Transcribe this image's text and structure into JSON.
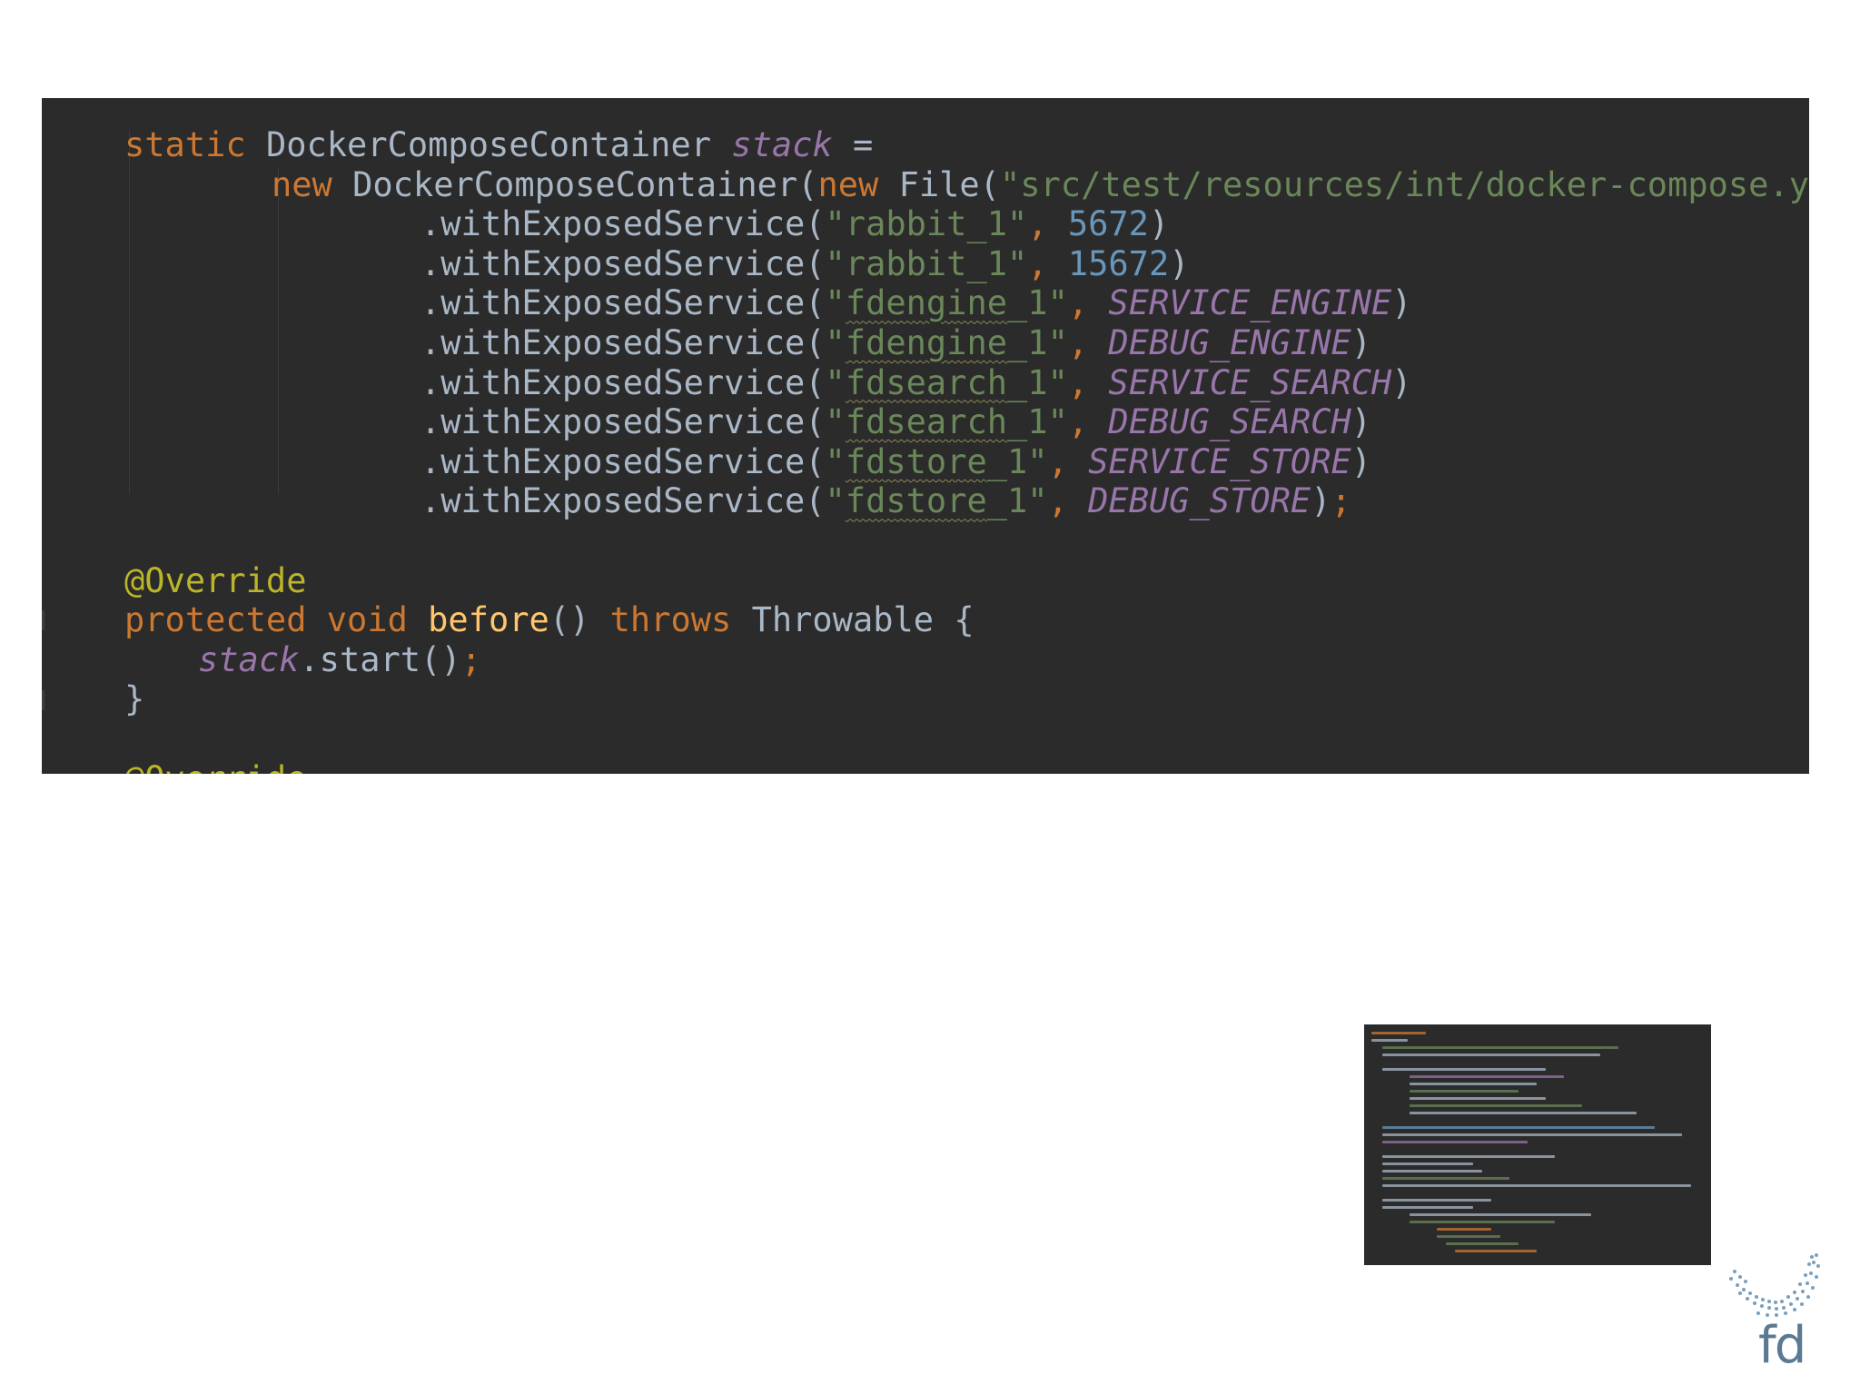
{
  "code": {
    "lines": [
      [
        [
          "kw",
          "static "
        ],
        [
          "cls",
          "DockerComposeContainer "
        ],
        [
          "field",
          "stack"
        ],
        [
          "punct",
          " ="
        ]
      ],
      [
        [
          "kw",
          "new "
        ],
        [
          "cls",
          "DockerComposeContainer("
        ],
        [
          "kw",
          "new "
        ],
        [
          "cls",
          "File("
        ],
        [
          "str",
          "\"src/test/resources/int/docker-compose.yml\""
        ],
        [
          "punct",
          "))"
        ]
      ],
      [
        [
          "punct",
          ".withExposedService("
        ],
        [
          "str",
          "\"rabbit_1\""
        ],
        [
          "kw",
          ", "
        ],
        [
          "num",
          "5672"
        ],
        [
          "punct",
          ")"
        ]
      ],
      [
        [
          "punct",
          ".withExposedService("
        ],
        [
          "str",
          "\"rabbit_1\""
        ],
        [
          "kw",
          ", "
        ],
        [
          "num",
          "15672"
        ],
        [
          "punct",
          ")"
        ]
      ],
      [
        [
          "punct",
          ".withExposedService("
        ],
        [
          "str",
          "\""
        ],
        [
          "str typo",
          "fdengine"
        ],
        [
          "str",
          "_1\""
        ],
        [
          "kw",
          ", "
        ],
        [
          "const",
          "SERVICE_ENGINE"
        ],
        [
          "punct",
          ")"
        ]
      ],
      [
        [
          "punct",
          ".withExposedService("
        ],
        [
          "str",
          "\""
        ],
        [
          "str typo",
          "fdengine"
        ],
        [
          "str",
          "_1\""
        ],
        [
          "kw",
          ", "
        ],
        [
          "const",
          "DEBUG_ENGINE"
        ],
        [
          "punct",
          ")"
        ]
      ],
      [
        [
          "punct",
          ".withExposedService("
        ],
        [
          "str",
          "\""
        ],
        [
          "str typo",
          "fdsearch"
        ],
        [
          "str",
          "_1\""
        ],
        [
          "kw",
          ", "
        ],
        [
          "const",
          "SERVICE_SEARCH"
        ],
        [
          "punct",
          ")"
        ]
      ],
      [
        [
          "punct",
          ".withExposedService("
        ],
        [
          "str",
          "\""
        ],
        [
          "str typo",
          "fdsearch"
        ],
        [
          "str",
          "_1\""
        ],
        [
          "kw",
          ", "
        ],
        [
          "const",
          "DEBUG_SEARCH"
        ],
        [
          "punct",
          ")"
        ]
      ],
      [
        [
          "punct",
          ".withExposedService("
        ],
        [
          "str",
          "\""
        ],
        [
          "str typo",
          "fdstore"
        ],
        [
          "str",
          "_1\""
        ],
        [
          "kw",
          ", "
        ],
        [
          "const",
          "SERVICE_STORE"
        ],
        [
          "punct",
          ")"
        ]
      ],
      [
        [
          "punct",
          ".withExposedService("
        ],
        [
          "str",
          "\""
        ],
        [
          "str typo",
          "fdstore"
        ],
        [
          "str",
          "_1\""
        ],
        [
          "kw",
          ", "
        ],
        [
          "const",
          "DEBUG_STORE"
        ],
        [
          "punct",
          ")"
        ],
        [
          "semi",
          ";"
        ]
      ],
      [],
      [
        [
          "ann",
          "@Override"
        ]
      ],
      [
        [
          "kw",
          "protected "
        ],
        [
          "kw",
          "void "
        ],
        [
          "method",
          "before"
        ],
        [
          "punct",
          "() "
        ],
        [
          "kw",
          "throws "
        ],
        [
          "cls",
          "Throwable "
        ],
        [
          "punct",
          "{"
        ]
      ],
      [
        [
          "field",
          "stack"
        ],
        [
          "punct",
          ".start()"
        ],
        [
          "semi",
          ";"
        ]
      ],
      [
        [
          "punct",
          "}"
        ]
      ],
      [],
      [
        [
          "ann",
          "@Override"
        ]
      ]
    ]
  },
  "logo_text": "fd",
  "colors": {
    "editor_bg": "#2b2b2b",
    "keyword": "#cc7832",
    "string": "#6a8759",
    "number": "#6897bb",
    "field": "#9876aa",
    "annotation": "#bbb529",
    "method": "#ffc66d",
    "logo": "#5a7a94"
  },
  "icons": [
    "fd-logo-icon"
  ]
}
